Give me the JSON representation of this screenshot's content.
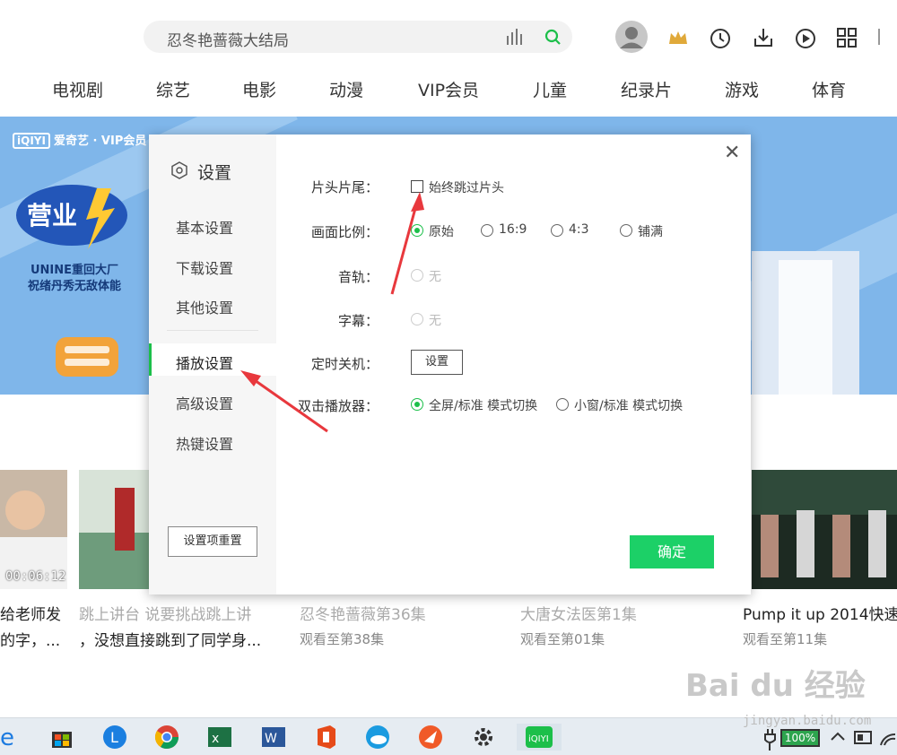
{
  "search": {
    "query": "忍冬艳蔷薇大结局"
  },
  "nav": {
    "items": [
      "电视剧",
      "综艺",
      "电影",
      "动漫",
      "VIP会员",
      "儿童",
      "纪录片",
      "游戏",
      "体育"
    ]
  },
  "banner": {
    "brand": "爱奇艺 · VIP会员",
    "logo": "iQIYI",
    "promo_line1": "UNINE重回大厂",
    "promo_line2": "祝绪丹秀无敌体能"
  },
  "content": {
    "cards": [
      {
        "duration": "00:06:12",
        "title": "给老师发",
        "subtitle": "的字，..."
      },
      {
        "title": "跳上讲台 说要挑战跳上讲",
        "subtitle": "，没想直接跳到了同学身..."
      },
      {
        "title": "忍冬艳蔷薇第36集",
        "subtitle": "观看至第38集"
      },
      {
        "title": "大唐女法医第1集",
        "subtitle": "观看至第01集"
      },
      {
        "title": "Pump it up 2014快速",
        "subtitle": "观看至第11集"
      }
    ]
  },
  "dialog": {
    "title": "设置",
    "close_label": "✕",
    "menu": [
      "基本设置",
      "下载设置",
      "其他设置",
      "播放设置",
      "高级设置",
      "热键设置"
    ],
    "reset_label": "设置项重置",
    "ok_label": "确定",
    "rows": {
      "intro": {
        "label": "片头片尾：",
        "option": "始终跳过片头"
      },
      "ratio": {
        "label": "画面比例：",
        "options": [
          "原始",
          "16:9",
          "4:3",
          "铺满"
        ]
      },
      "audio": {
        "label": "音轨：",
        "option": "无"
      },
      "subtitle": {
        "label": "字幕：",
        "option": "无"
      },
      "timer": {
        "label": "定时关机：",
        "button": "设置"
      },
      "dblclick": {
        "label": "双击播放器：",
        "options": [
          "全屏/标准 模式切换",
          "小窗/标准 模式切换"
        ]
      }
    }
  },
  "taskbar": {
    "battery": "100%"
  },
  "watermark": {
    "text": "Bai du 经验",
    "url": "jingyan.baidu.com"
  },
  "colors": {
    "accent": "#1cbf4a",
    "ok_button": "#1cd067",
    "annotation": "#e8383d",
    "banner": "#7fb6ea"
  }
}
